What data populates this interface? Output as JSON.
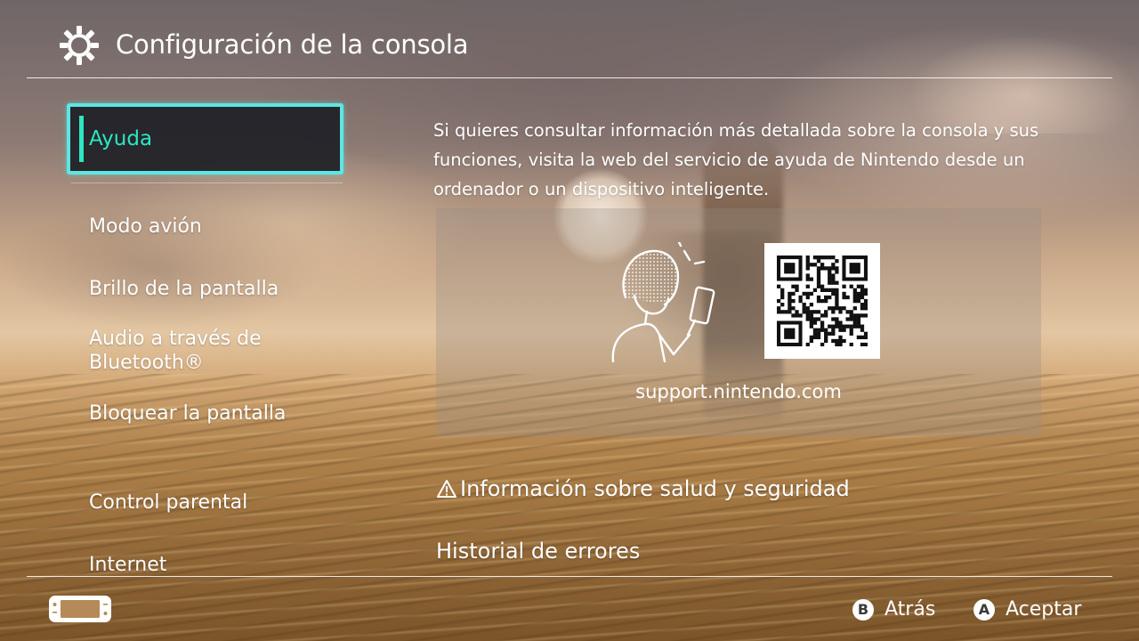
{
  "header": {
    "title": "Configuración de la consola",
    "icon": "gear-icon"
  },
  "sidebar": {
    "items": [
      {
        "label": "Ayuda",
        "selected": true
      },
      {
        "label": "Modo avión"
      },
      {
        "label": "Brillo de la pantalla"
      },
      {
        "label": "Audio a través de Bluetooth®"
      },
      {
        "label": "Bloquear la pantalla"
      },
      {
        "label": "Control parental"
      },
      {
        "label": "Internet"
      }
    ]
  },
  "main": {
    "description": "Si quieres consultar información más detallada sobre la consola y sus funciones, visita la web del servicio de ayuda de Nintendo desde un ordenador o un dispositivo inteligente.",
    "support_url": "support.nintendo.com",
    "links": [
      {
        "label": "Información sobre salud y seguridad",
        "icon": "warning-icon"
      },
      {
        "label": "Historial de errores"
      }
    ]
  },
  "footer": {
    "console_icon": "switch-console-icon",
    "buttons": [
      {
        "key": "B",
        "label": "Atrás"
      },
      {
        "key": "A",
        "label": "Aceptar"
      }
    ]
  },
  "colors": {
    "accent": "#2ce6c4",
    "selection_border": "#5ee6e3"
  }
}
